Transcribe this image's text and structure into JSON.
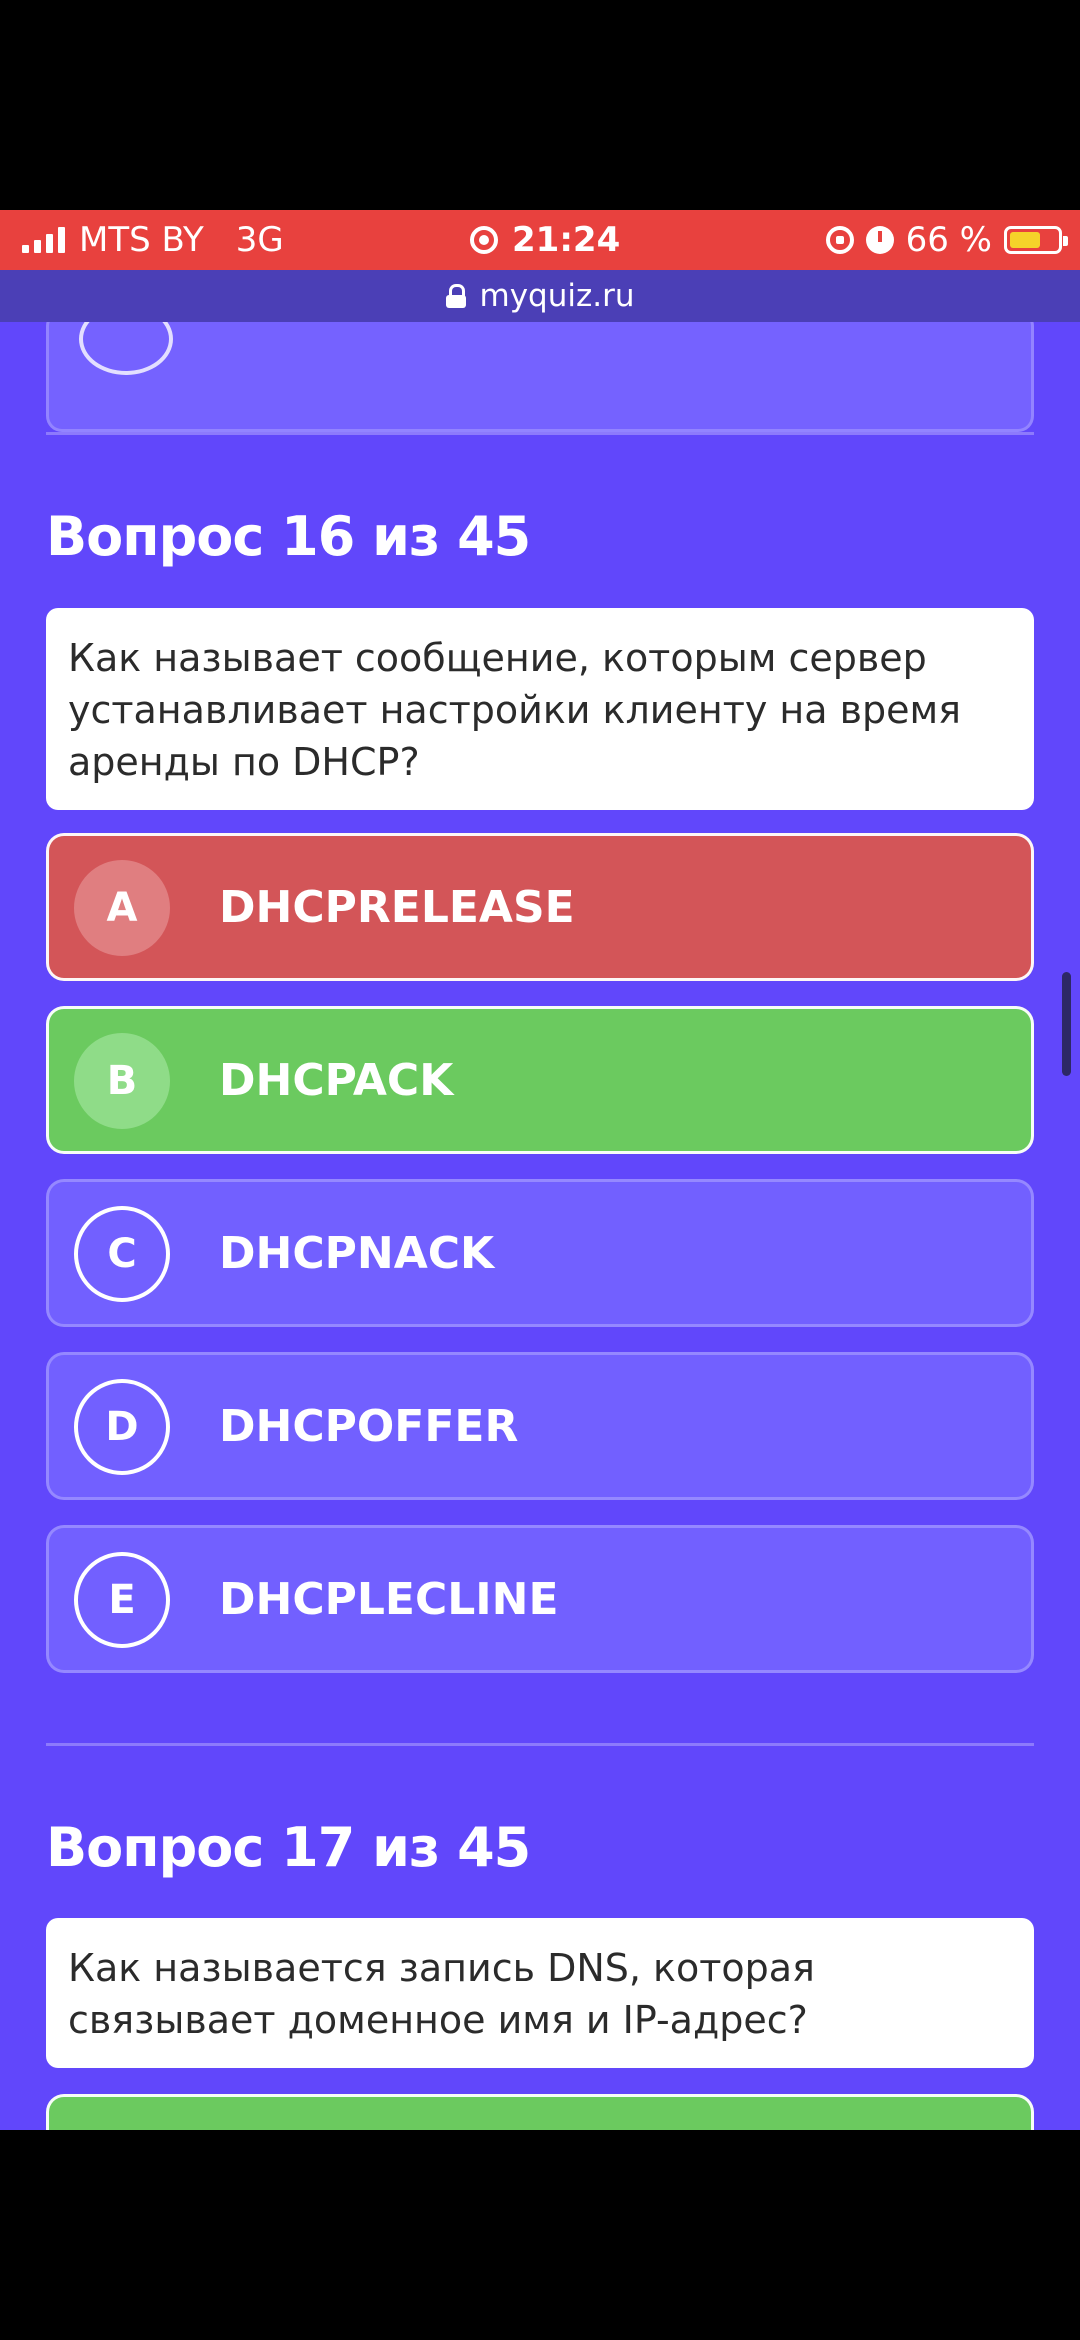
{
  "status_bar": {
    "carrier": "MTS BY",
    "network": "3G",
    "time": "21:24",
    "battery": "66 %",
    "battery_level": 0.66,
    "icons": [
      "signal-icon",
      "record-icon",
      "orientation-lock-icon",
      "alarm-icon",
      "battery-icon"
    ]
  },
  "browser": {
    "url": "myquiz.ru"
  },
  "question16": {
    "title": "Вопрос 16 из 45",
    "text": "Как называет сообщение, которым сервер устанавливает настройки клиенту на время аренды по DHCP?",
    "options": [
      {
        "letter": "A",
        "label": "DHCPRELEASE",
        "state": "wrong"
      },
      {
        "letter": "B",
        "label": "DHCPACK",
        "state": "correct"
      },
      {
        "letter": "C",
        "label": "DHCPNACK",
        "state": "neutral"
      },
      {
        "letter": "D",
        "label": "DHCPOFFER",
        "state": "neutral"
      },
      {
        "letter": "E",
        "label": "DHCPLECLINE",
        "state": "neutral"
      }
    ]
  },
  "question17": {
    "title": "Вопрос 17 из 45",
    "text": "Как называется запись DNS, которая связывает доменное имя и IP-адрес?"
  },
  "colors": {
    "background": "#6147fb",
    "status_bar": "#e8413e",
    "url_bar": "#4b3fb6",
    "wrong": "#d35558",
    "correct": "#6bca5f",
    "neutral_option": "#7260ff"
  }
}
